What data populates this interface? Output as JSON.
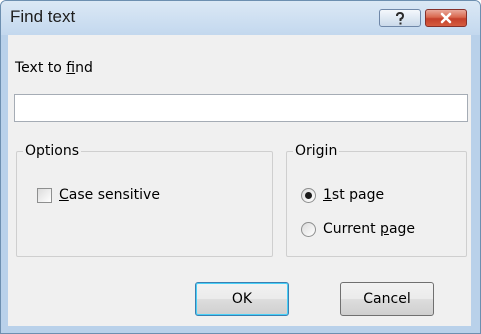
{
  "window": {
    "title": "Find text",
    "help_button_icon": "help-icon",
    "close_button_icon": "close-icon"
  },
  "find": {
    "label_prefix": "Text to ",
    "label_accel": "f",
    "label_suffix": "ind",
    "value": ""
  },
  "options": {
    "legend": "Options",
    "case_sensitive": {
      "accel": "C",
      "rest": "ase sensitive",
      "checked": false
    }
  },
  "origin": {
    "legend": "Origin",
    "first_page": {
      "accel": "1",
      "rest": "st page",
      "selected": true
    },
    "current_page": {
      "prefix": "Current ",
      "accel": "p",
      "rest": "age",
      "selected": false
    }
  },
  "buttons": {
    "ok": "OK",
    "cancel": "Cancel"
  },
  "colors": {
    "titlebar": "#c3d8ee",
    "frame": "#b9d1ea",
    "client": "#f0f0f0",
    "close_button": "#c5402b"
  }
}
